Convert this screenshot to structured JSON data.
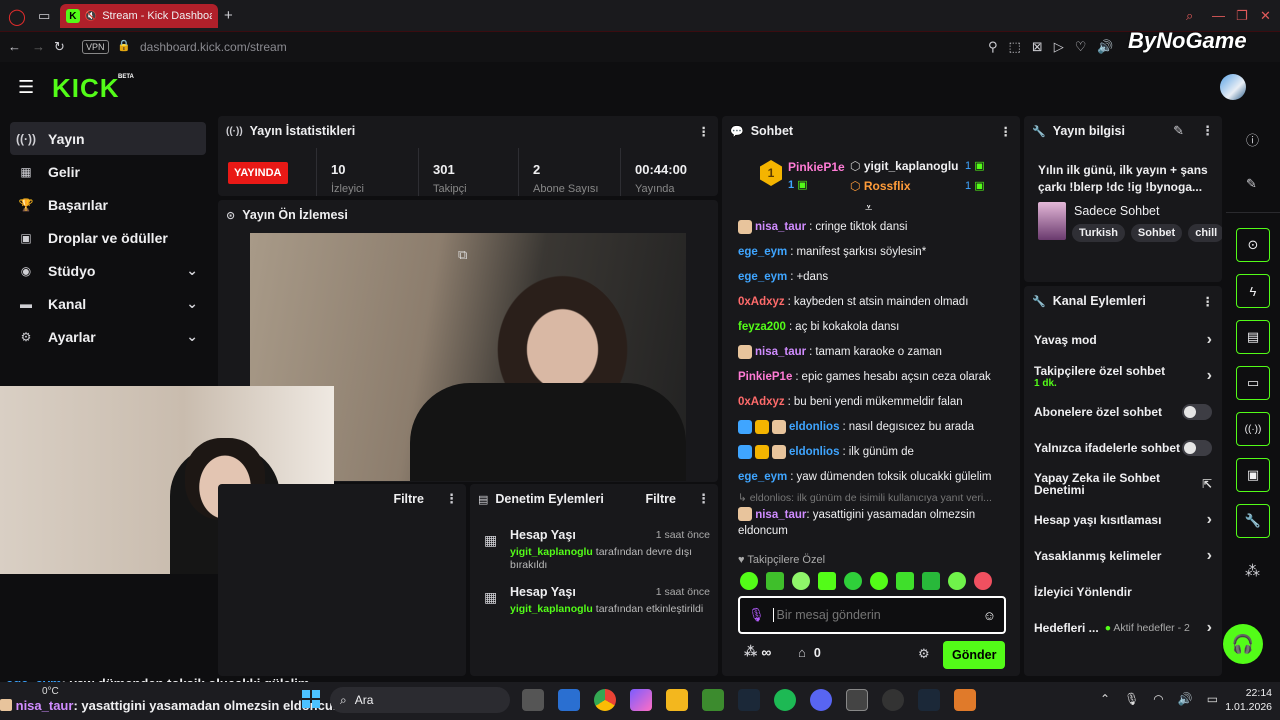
{
  "browser": {
    "tab_title": "Stream - Kick Dashboard",
    "vpn_label": "VPN",
    "url_domain": "dashboard.kick.com",
    "url_path": "/stream",
    "watermark": "ByNoGame"
  },
  "app": {
    "logo": "KICK",
    "logo_beta": "BETA"
  },
  "nav": [
    {
      "label": "Yayın",
      "icon": "broadcast-icon",
      "glyph": "((·))",
      "active": true,
      "chev": false
    },
    {
      "label": "Gelir",
      "icon": "chart-icon",
      "glyph": "▦",
      "active": false,
      "chev": false
    },
    {
      "label": "Başarılar",
      "icon": "trophy-icon",
      "glyph": "🏆",
      "active": false,
      "chev": false
    },
    {
      "label": "Droplar ve ödüller",
      "icon": "gift-icon",
      "glyph": "▣",
      "active": false,
      "chev": false
    },
    {
      "label": "Stüdyo",
      "icon": "studio-icon",
      "glyph": "◉",
      "active": false,
      "chev": true
    },
    {
      "label": "Kanal",
      "icon": "channel-icon",
      "glyph": "▬",
      "active": false,
      "chev": true
    },
    {
      "label": "Ayarlar",
      "icon": "gear-icon",
      "glyph": "⚙",
      "active": false,
      "chev": true
    }
  ],
  "stats": {
    "title": "Yayın İstatistikleri",
    "live_badge": "YAYINDA",
    "items": [
      {
        "value": "10",
        "label": "İzleyici"
      },
      {
        "value": "301",
        "label": "Takipçi"
      },
      {
        "value": "2",
        "label": "Abone Sayısı"
      },
      {
        "value": "00:44:00",
        "label": "Yayında"
      }
    ]
  },
  "preview": {
    "title": "Yayın Ön İzlemesi"
  },
  "filter_panel": {
    "filter_label": "Filtre"
  },
  "moderation": {
    "title": "Denetim Eylemleri",
    "filter_label": "Filtre",
    "items": [
      {
        "title": "Hesap Yaşı",
        "time": "1 saat önce",
        "user": "yigit_kaplanoglu",
        "text": "tarafından devre dışı bırakıldı"
      },
      {
        "title": "Hesap Yaşı",
        "time": "1 saat önce",
        "user": "yigit_kaplanoglu",
        "text": "tarafından etkinleştirildi"
      }
    ]
  },
  "chat": {
    "title": "Sohbet",
    "leaders": [
      {
        "name": "PinkieP1e",
        "count": "1",
        "color": "#ff7bd5"
      },
      {
        "name": "yigit_kaplanoglu",
        "count": "1",
        "color": "#efeff1"
      },
      {
        "name": "Rossflix",
        "count": "1",
        "color": "#ff9c3a"
      }
    ],
    "messages": [
      {
        "user": "nisa_taur",
        "color": "#d08cff",
        "text": "cringe tiktok dansi",
        "badges": 1
      },
      {
        "user": "ege_eym",
        "color": "#3fa5ff",
        "text": "manifest şarkısı söylesin*",
        "badges": 0
      },
      {
        "user": "ege_eym",
        "color": "#3fa5ff",
        "text": "+dans",
        "badges": 0
      },
      {
        "user": "0xAdxyz",
        "color": "#ff6b6b",
        "text": "kaybeden st atsin mainden olmadı",
        "badges": 0
      },
      {
        "user": "feyza200",
        "color": "#53fc18",
        "text": "aç bi kokakola dansı",
        "badges": 0
      },
      {
        "user": "nisa_taur",
        "color": "#d08cff",
        "text": "tamam karaoke o zaman",
        "badges": 1
      },
      {
        "user": "PinkieP1e",
        "color": "#ff7bd5",
        "text": "epic games hesabı açsın ceza olarak",
        "badges": 0
      },
      {
        "user": "0xAdxyz",
        "color": "#ff6b6b",
        "text": "bu beni yendi mükemmeldir falan",
        "badges": 0
      },
      {
        "user": "eldonlios",
        "color": "#3fa5ff",
        "text": "nasıl degısıcez bu arada",
        "badges": 3
      },
      {
        "user": "eldonlios",
        "color": "#3fa5ff",
        "text": "ilk günüm de",
        "badges": 3
      },
      {
        "user": "ege_eym",
        "color": "#3fa5ff",
        "text": "yaw dümenden toksik olucakki gülelim",
        "badges": 0
      }
    ],
    "reply_hint": "eldonlios: ilk günüm de isimili kullanıcıya yanıt veri...",
    "last_message": {
      "user": "nisa_taur",
      "color": "#d08cff",
      "text": "yasattigini yasamadan olmezsin eldoncum"
    },
    "followers_only": "Takipçilere Özel",
    "input_placeholder": "Bir mesaj gönderin",
    "points_label": "∞",
    "count_label": "0",
    "send_label": "Gönder"
  },
  "stream_info": {
    "title": "Yayın bilgisi",
    "stream_title": "Yılın ilk günü, ilk yayın + şans çarkı !blerp !dc !ig !bynoga...",
    "category": "Sadece Sohbet",
    "tags": [
      "Turkish",
      "Sohbet",
      "chill"
    ]
  },
  "channel_actions": {
    "title": "Kanal Eylemleri",
    "items": [
      {
        "label": "Yavaş mod",
        "kind": "chev",
        "sub": ""
      },
      {
        "label": "Takipçilere özel sohbet",
        "kind": "chev",
        "sub": "1 dk."
      },
      {
        "label": "Abonelere özel sohbet",
        "kind": "toggle",
        "sub": ""
      },
      {
        "label": "Yalnızca ifadelerle sohbet",
        "kind": "toggle",
        "sub": ""
      },
      {
        "label": "Yapay Zeka ile Sohbet Denetimi",
        "kind": "ext",
        "sub": ""
      },
      {
        "label": "Hesap yaşı kısıtlaması",
        "kind": "chev",
        "sub": ""
      },
      {
        "label": "Yasaklanmış kelimeler",
        "kind": "chev",
        "sub": ""
      },
      {
        "label": "İzleyici Yönlendir",
        "kind": "none",
        "sub": ""
      }
    ],
    "goals_label": "Hedefleri ...",
    "goals_status": "Aktif hedefler - 2"
  },
  "overlay": {
    "line1_user": "ege_eym",
    "line1_text": ": yaw dümenden toksik olucakki gülelim",
    "line2_user": "nisa_taur",
    "line2_text": ": yasattigini yasamadan olmezsin eldoncum"
  },
  "taskbar": {
    "weather": "0°C",
    "search": "Ara",
    "time": "22:14",
    "date": "1.01.2026"
  },
  "colors": {
    "accent": "#53fc18",
    "live": "#e91916",
    "browser_tab": "#b0202a"
  }
}
